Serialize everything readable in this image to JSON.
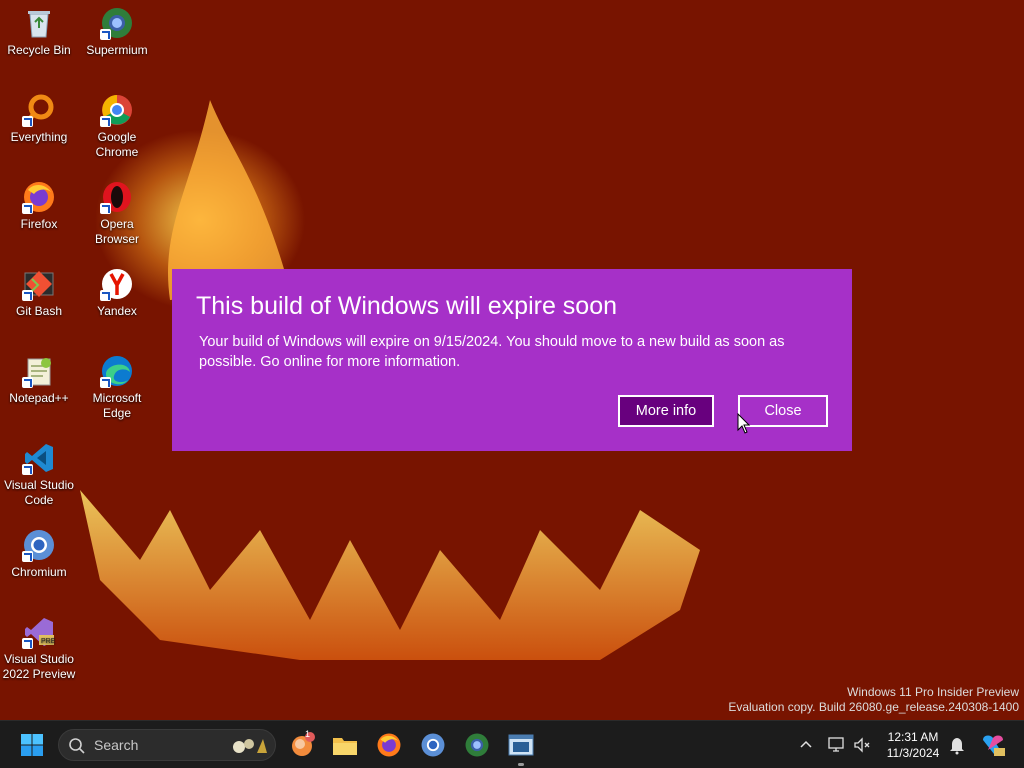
{
  "desktop": {
    "icons": [
      {
        "label": "Recycle Bin",
        "icon": "recycle-bin-icon"
      },
      {
        "label": "Supermium",
        "icon": "supermium-icon"
      },
      {
        "label": "Everything",
        "icon": "everything-icon"
      },
      {
        "label": "Google Chrome",
        "icon": "chrome-icon"
      },
      {
        "label": "Firefox",
        "icon": "firefox-icon"
      },
      {
        "label": "Opera Browser",
        "icon": "opera-icon"
      },
      {
        "label": "Git Bash",
        "icon": "git-bash-icon"
      },
      {
        "label": "Yandex",
        "icon": "yandex-icon"
      },
      {
        "label": "Notepad++",
        "icon": "notepad-plus-plus-icon"
      },
      {
        "label": "Microsoft Edge",
        "icon": "edge-icon"
      },
      {
        "label": "Visual Studio Code",
        "icon": "vscode-icon"
      },
      {
        "label": "Chromium",
        "icon": "chromium-icon"
      },
      {
        "label": "Visual Studio 2022 Preview",
        "icon": "visual-studio-preview-icon"
      }
    ]
  },
  "dialog": {
    "title": "This build of Windows will expire soon",
    "message": "Your build of Windows will expire on 9/15/2024. You should move to a new build as soon as possible. Go online for more information.",
    "more_info_label": "More info",
    "close_label": "Close",
    "background_color": "#a630c8",
    "primary_button_color": "#68007e"
  },
  "watermark": {
    "line1": "Windows 11 Pro Insider Preview",
    "line2": "Evaluation copy. Build 26080.ge_release.240308-1400"
  },
  "taskbar": {
    "search_placeholder": "Search",
    "apps": [
      "start-icon",
      "copilot-icon",
      "file-explorer-icon",
      "firefox-icon",
      "chromium-icon",
      "supermium-icon",
      "app-window-icon"
    ],
    "notification_badge": "1",
    "time": "12:31 AM",
    "date": "11/3/2024"
  }
}
